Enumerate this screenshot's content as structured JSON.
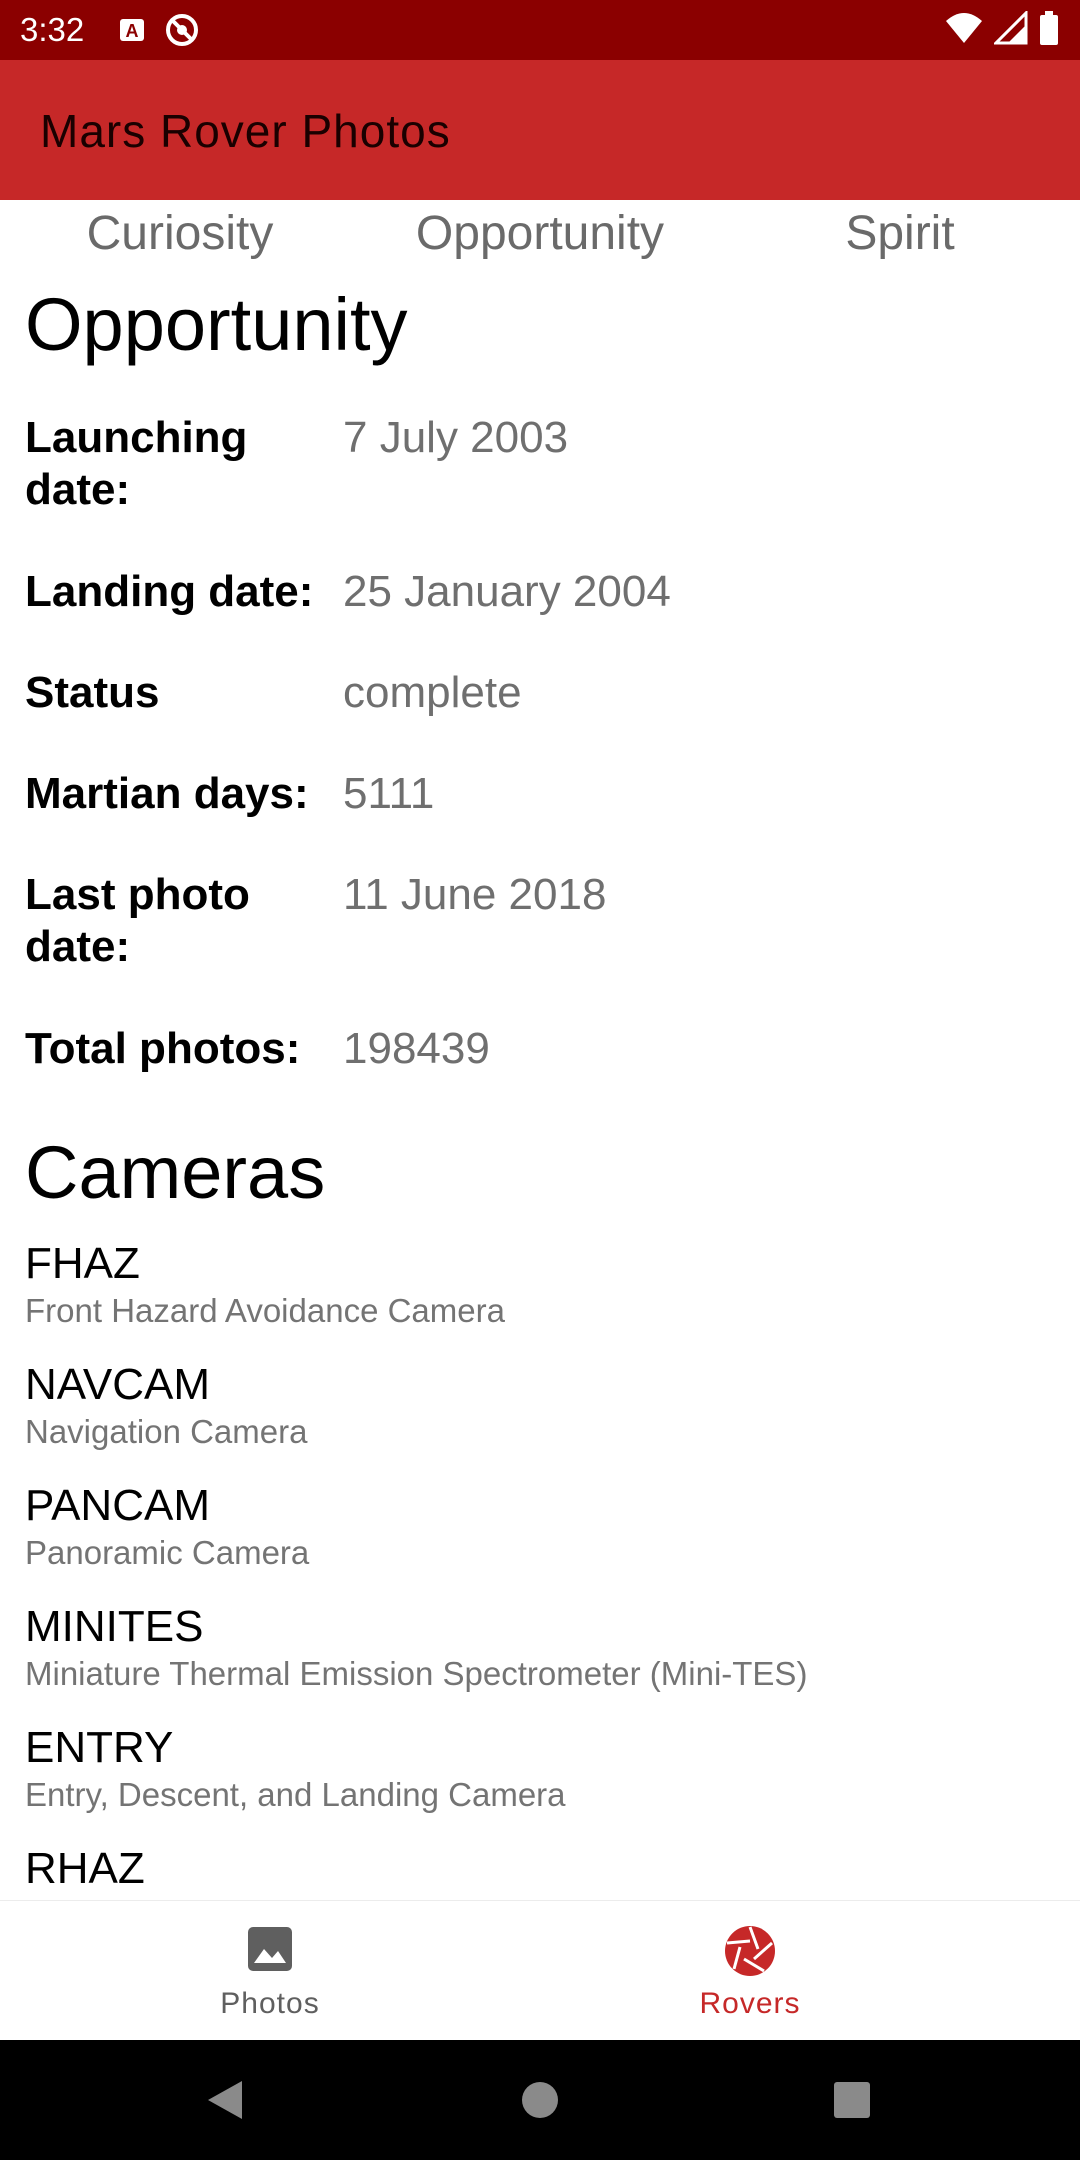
{
  "status_bar": {
    "time": "3:32",
    "left_icons": [
      "text-a-icon",
      "no-entry-icon"
    ],
    "right_icons": [
      "wifi-icon",
      "cell-signal-icon",
      "battery-icon"
    ]
  },
  "app_bar": {
    "title": "Mars Rover Photos"
  },
  "tabs": [
    {
      "label": "Curiosity"
    },
    {
      "label": "Opportunity"
    },
    {
      "label": "Spirit"
    }
  ],
  "rover": {
    "name": "Opportunity",
    "details": [
      {
        "label": "Launching date:",
        "value": "7 July 2003"
      },
      {
        "label": "Landing date:",
        "value": "25 January 2004"
      },
      {
        "label": "Status",
        "value": "complete"
      },
      {
        "label": "Martian days:",
        "value": "5111"
      },
      {
        "label": "Last photo date:",
        "value": "11 June 2018"
      },
      {
        "label": "Total photos:",
        "value": "198439"
      }
    ]
  },
  "cameras": {
    "title": "Cameras",
    "items": [
      {
        "name": "FHAZ",
        "description": "Front Hazard Avoidance Camera"
      },
      {
        "name": "NAVCAM",
        "description": "Navigation Camera"
      },
      {
        "name": "PANCAM",
        "description": "Panoramic Camera"
      },
      {
        "name": "MINITES",
        "description": "Miniature Thermal Emission Spectrometer (Mini-TES)"
      },
      {
        "name": "ENTRY",
        "description": "Entry, Descent, and Landing Camera"
      },
      {
        "name": "RHAZ",
        "description": ""
      }
    ]
  },
  "bottom_nav": {
    "items": [
      {
        "label": "Photos",
        "icon": "image-icon",
        "selected": false
      },
      {
        "label": "Rovers",
        "icon": "aperture-icon",
        "selected": true
      }
    ]
  },
  "colors": {
    "status_bar": "#8b0000",
    "app_bar": "#c62828",
    "accent": "#c62828",
    "value_text": "#6f6f6f",
    "system_nav": "#000000"
  },
  "system_nav": {
    "buttons": [
      "back-icon",
      "home-icon",
      "recents-icon"
    ]
  }
}
